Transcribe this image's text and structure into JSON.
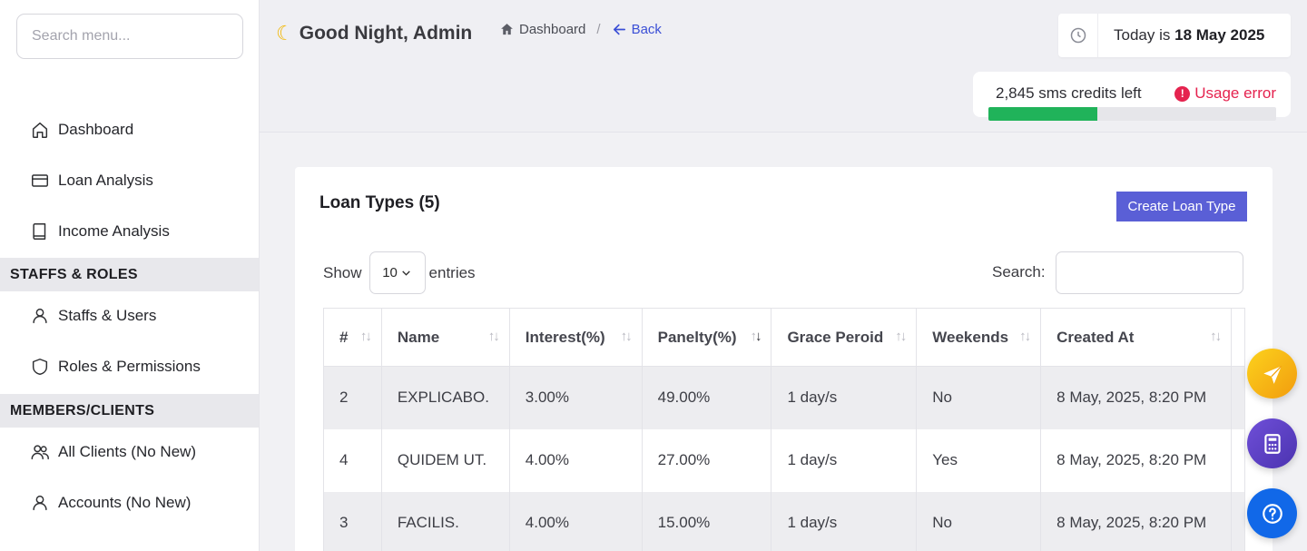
{
  "sidebar": {
    "search_placeholder": "Search menu...",
    "items": [
      {
        "label": "Dashboard",
        "icon": "home-icon"
      },
      {
        "label": "Loan Analysis",
        "icon": "credit-card-icon"
      },
      {
        "label": "Income Analysis",
        "icon": "book-icon"
      }
    ],
    "sections": [
      {
        "title": "STAFFS & ROLES",
        "items": [
          {
            "label": "Staffs & Users",
            "icon": "user-icon"
          },
          {
            "label": "Roles & Permissions",
            "icon": "shield-icon"
          }
        ]
      },
      {
        "title": "MEMBERS/CLIENTS",
        "items": [
          {
            "label": "All Clients (No New)",
            "icon": "users-icon"
          },
          {
            "label": "Accounts (No New)",
            "icon": "user-icon"
          }
        ]
      }
    ]
  },
  "header": {
    "greeting": "Good Night, Admin",
    "breadcrumb_home": "Dashboard",
    "breadcrumb_sep": "/",
    "back_label": "Back",
    "date_prefix": "Today is",
    "date_value": "18 May 2025",
    "sms_credits": "2,845 sms credits left",
    "usage_error": "Usage error",
    "usage_error_badge": "!",
    "usage_progress_percent": 38,
    "accent_color": "#20b35a",
    "error_color": "#e5234f"
  },
  "card": {
    "title": "Loan Types (5)",
    "create_button": "Create Loan Type",
    "show_label": "Show",
    "entries_value": "10",
    "entries_label": "entries",
    "search_label": "Search:",
    "columns": [
      "#",
      "Name",
      "Interest(%)",
      "Panelty(%)",
      "Grace Peroid",
      "Weekends",
      "Created At"
    ],
    "sort_icon": "↑↓",
    "rows": [
      [
        "2",
        "EXPLICABO.",
        "3.00%",
        "49.00%",
        "1 day/s",
        "No",
        "8 May, 2025, 8:20 PM"
      ],
      [
        "4",
        "QUIDEM UT.",
        "4.00%",
        "27.00%",
        "1 day/s",
        "Yes",
        "8 May, 2025, 8:20 PM"
      ],
      [
        "3",
        "FACILIS.",
        "4.00%",
        "15.00%",
        "1 day/s",
        "No",
        "8 May, 2025, 8:20 PM"
      ]
    ],
    "button_color": "#5a5fd6"
  }
}
